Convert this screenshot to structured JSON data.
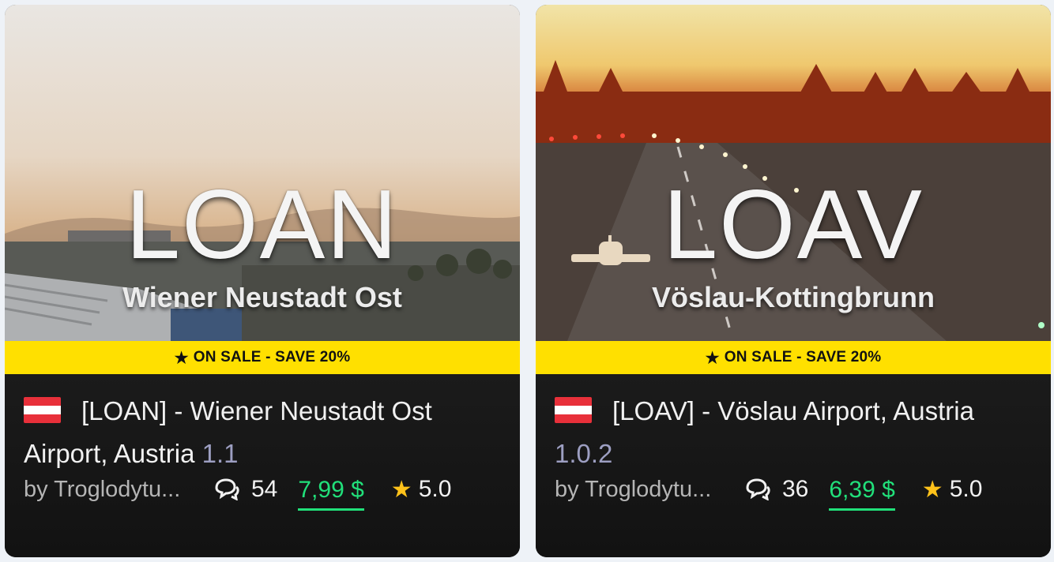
{
  "cards": [
    {
      "code": "LOAN",
      "subname": "Wiener Neustadt Ost",
      "sale": "ON SALE - SAVE 20%",
      "title": "[LOAN] - Wiener Neustadt Ost Airport, Austria",
      "version": "1.1",
      "author": "by Troglodytu...",
      "comments": "54",
      "price": "7,99 $",
      "rating": "5.0",
      "flag": "austria-flag"
    },
    {
      "code": "LOAV",
      "subname": "Vöslau-Kottingbrunn",
      "sale": "ON SALE - SAVE 20%",
      "title": "[LOAV] - Vöslau Airport, Austria",
      "version": "1.0.2",
      "author": "by Troglodytu...",
      "comments": "36",
      "price": "6,39 $",
      "rating": "5.0",
      "flag": "austria-flag"
    }
  ],
  "colors": {
    "sale_banner": "#ffe000",
    "price": "#21e07a",
    "version": "#9d9fc2",
    "star": "#ffc21a",
    "card_bg": "#121212"
  },
  "icons": [
    "star-icon",
    "comments-icon",
    "austria-flag"
  ]
}
